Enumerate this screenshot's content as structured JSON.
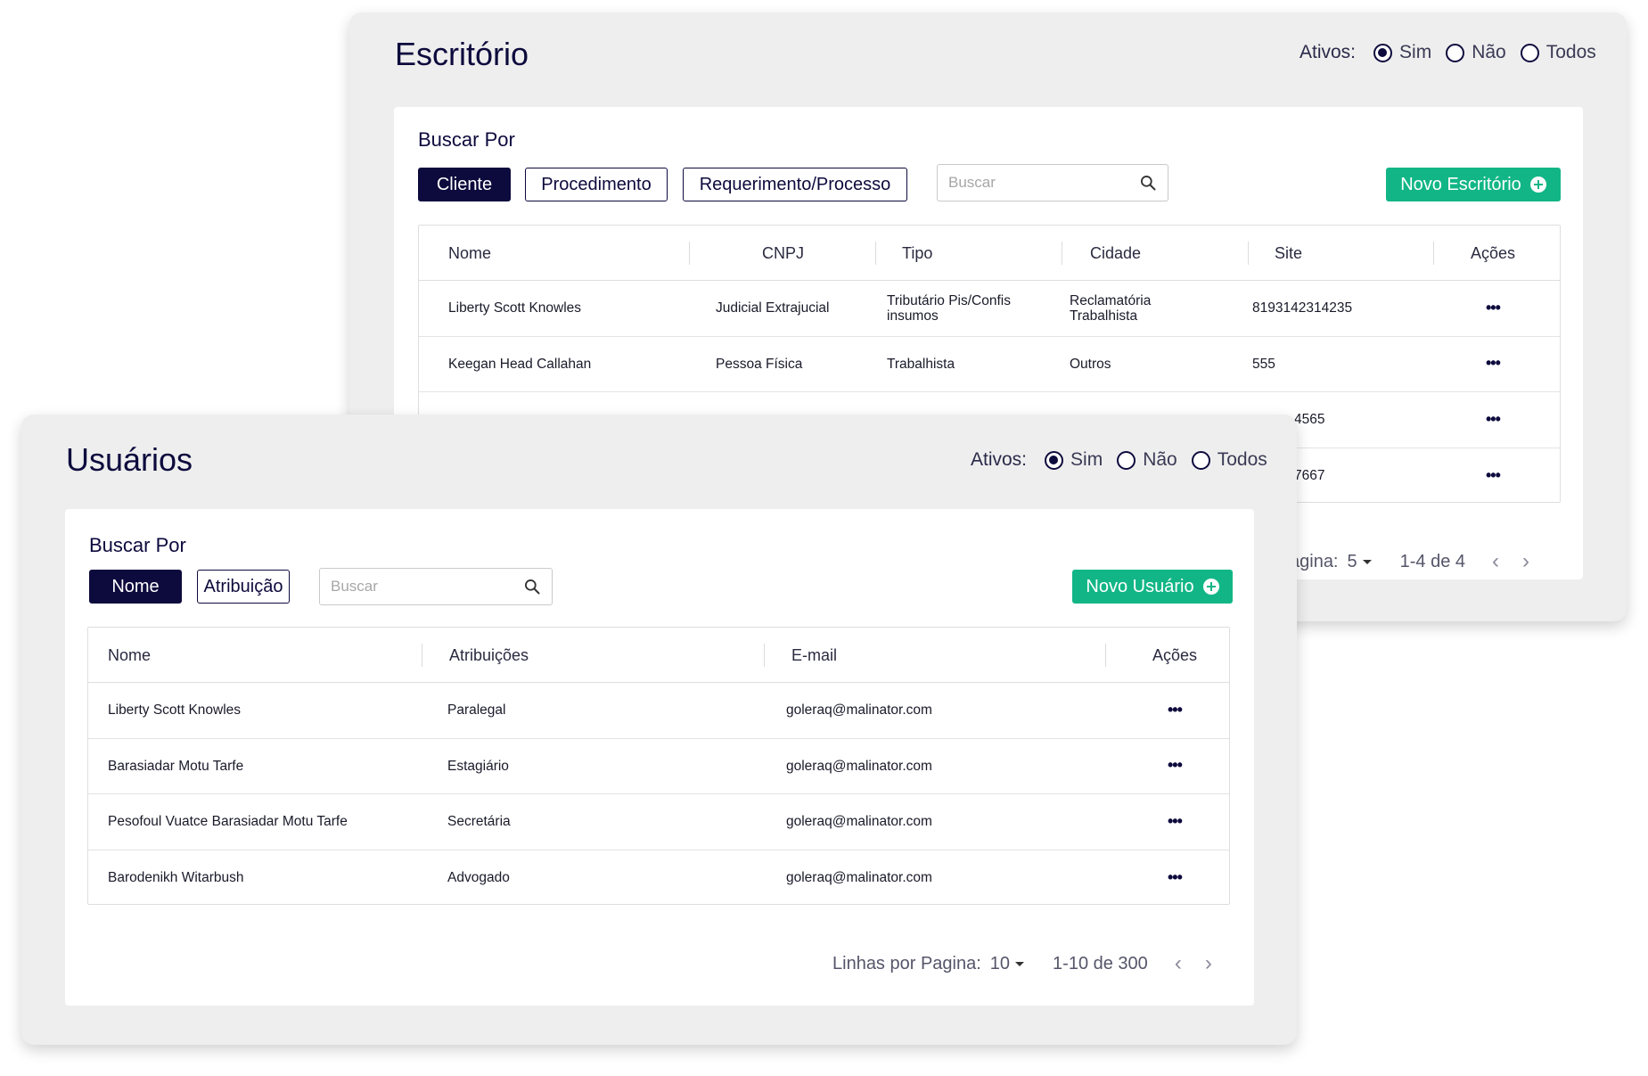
{
  "escritorio": {
    "title": "Escritório",
    "filter": {
      "label": "Ativos:",
      "options": [
        "Sim",
        "Não",
        "Todos"
      ],
      "selected": "Sim"
    },
    "buscar_por": "Buscar Por",
    "tabs": [
      "Cliente",
      "Procedimento",
      "Requerimento/Processo"
    ],
    "search_placeholder": "Buscar",
    "new_button": "Novo Escritório",
    "columns": [
      "Nome",
      "CNPJ",
      "Tipo",
      "Cidade",
      "Site",
      "Ações"
    ],
    "rows": [
      {
        "nome": "Liberty Scott Knowles",
        "cnpj": "Judicial Extrajucial",
        "tipo": "Tributário Pis/Confis insumos",
        "cidade": "Reclamatória Trabalhista",
        "site": "8193142314235",
        "acoes": "•••"
      },
      {
        "nome": "Keegan Head Callahan",
        "cnpj": "Pessoa Física",
        "tipo": "Trabalhista",
        "cidade": "Outros",
        "site": "555",
        "acoes": "•••"
      },
      {
        "site_fragment": "4565",
        "acoes": "•••"
      },
      {
        "site_fragment": "7667",
        "acoes": "•••"
      }
    ],
    "pagination": {
      "label_fragment": "agina:",
      "per_page": "5",
      "range": "1-4 de 4",
      "prev": "‹",
      "next": "›"
    }
  },
  "usuarios": {
    "title": "Usuários",
    "filter": {
      "label": "Ativos:",
      "options": [
        "Sim",
        "Não",
        "Todos"
      ],
      "selected": "Sim"
    },
    "buscar_por": "Buscar Por",
    "tabs": [
      "Nome",
      "Atribuição"
    ],
    "search_placeholder": "Buscar",
    "new_button": "Novo Usuário",
    "columns": [
      "Nome",
      "Atribuições",
      "E-mail",
      "Ações"
    ],
    "rows": [
      {
        "nome": "Liberty Scott Knowles",
        "atribuicao": "Paralegal",
        "email": "goleraq@malinator.com",
        "acoes": "•••"
      },
      {
        "nome": "Barasiadar Motu Tarfe",
        "atribuicao": "Estagiário",
        "email": "goleraq@malinator.com",
        "acoes": "•••"
      },
      {
        "nome": "Pesofoul Vuatce Barasiadar Motu Tarfe",
        "atribuicao": "Secretária",
        "email": "goleraq@malinator.com",
        "acoes": "•••"
      },
      {
        "nome": "Barodenikh Witarbush",
        "atribuicao": "Advogado",
        "email": "goleraq@malinator.com",
        "acoes": "•••"
      }
    ],
    "pagination": {
      "label": "Linhas por Pagina:",
      "per_page": "10",
      "range": "1-10 de 300",
      "prev": "‹",
      "next": "›"
    }
  },
  "colors": {
    "navy": "#0d0a3d",
    "green": "#12b686",
    "panel": "#eeeeee"
  },
  "icons": [
    "search-icon",
    "plus-circle-icon",
    "more-icon",
    "chevron-left-icon",
    "chevron-right-icon",
    "caret-down-icon"
  ]
}
